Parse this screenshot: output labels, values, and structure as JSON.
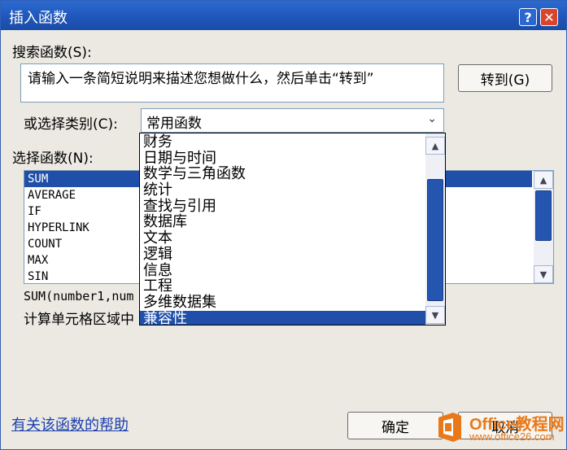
{
  "window": {
    "title": "插入函数",
    "help_btn": "?",
    "close_btn": "✕"
  },
  "search": {
    "label": "搜索函数(S):",
    "value": "请输入一条简短说明来描述您想做什么，然后单击“转到”",
    "goto_button": "转到(G)"
  },
  "category": {
    "label": "或选择类别(C):",
    "selected": "常用函数",
    "options": [
      "财务",
      "日期与时间",
      "数学与三角函数",
      "统计",
      "查找与引用",
      "数据库",
      "文本",
      "逻辑",
      "信息",
      "工程",
      "多维数据集",
      "兼容性"
    ],
    "highlighted_option": "兼容性"
  },
  "functions": {
    "label": "选择函数(N):",
    "items": [
      "SUM",
      "AVERAGE",
      "IF",
      "HYPERLINK",
      "COUNT",
      "MAX",
      "SIN"
    ],
    "selected": "SUM",
    "syntax": "SUM(number1,num",
    "description": "计算单元格区域中"
  },
  "footer": {
    "help_link": "有关该函数的帮助",
    "ok_button": "确定",
    "cancel_button": "取消"
  },
  "watermark": {
    "line1": "Office教程网",
    "line2": "www.office26.com"
  },
  "colors": {
    "titlebar": "#1f55b8",
    "selection": "#1f4fa8",
    "link": "#1a3fb0",
    "brand": "#e8791a"
  }
}
